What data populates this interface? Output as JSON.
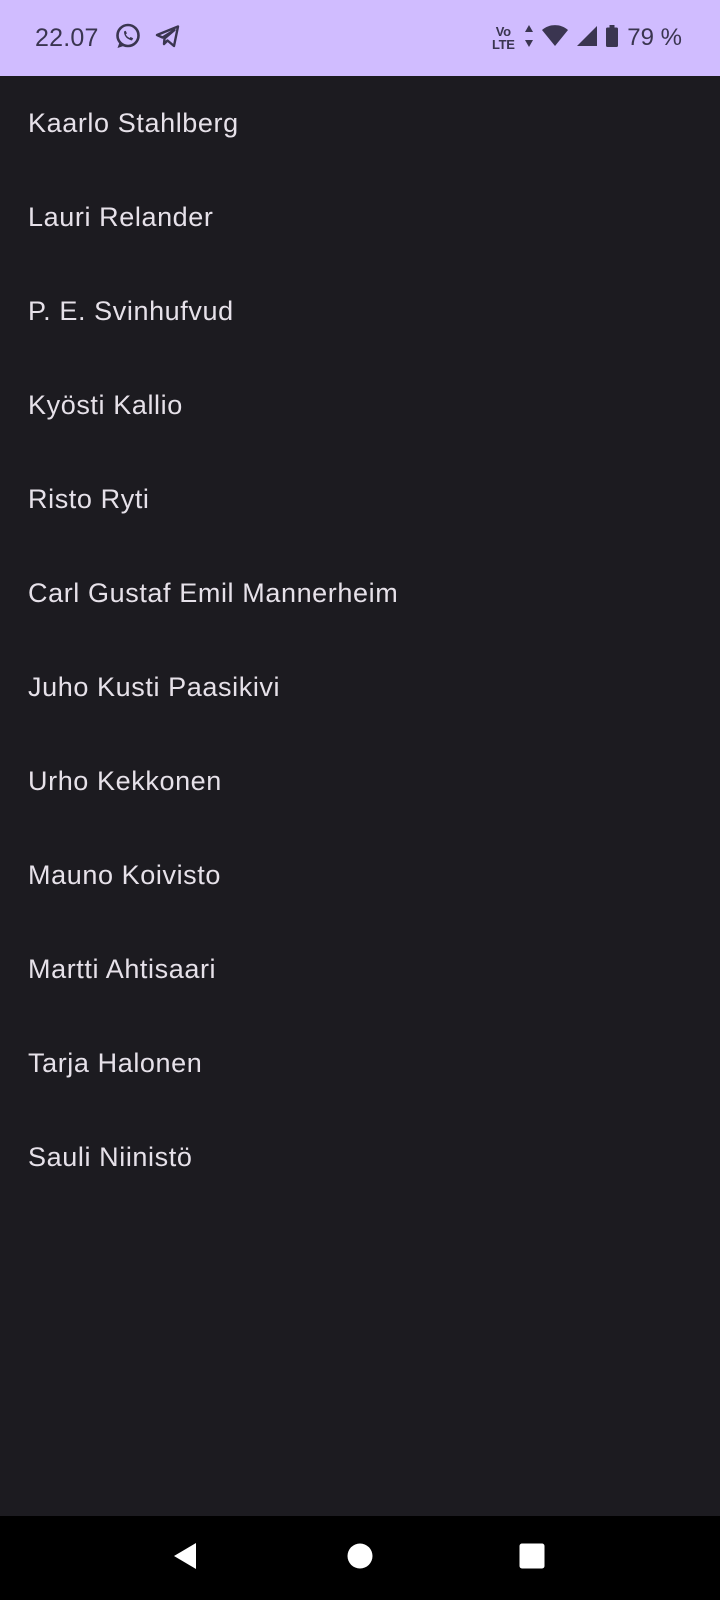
{
  "status_bar": {
    "time": "22.07",
    "left_icons": [
      "whatsapp-icon",
      "telegram-icon"
    ],
    "network_badge": [
      "Vo",
      "LTE"
    ],
    "battery_percent": "79 %",
    "background": "#d0bcff"
  },
  "presidents": {
    "items": [
      {
        "name": "Kaarlo Stahlberg"
      },
      {
        "name": "Lauri Relander"
      },
      {
        "name": "P. E. Svinhufvud"
      },
      {
        "name": "Kyösti Kallio"
      },
      {
        "name": "Risto Ryti"
      },
      {
        "name": "Carl Gustaf Emil Mannerheim"
      },
      {
        "name": "Juho Kusti Paasikivi"
      },
      {
        "name": "Urho Kekkonen"
      },
      {
        "name": "Mauno Koivisto"
      },
      {
        "name": "Martti Ahtisaari"
      },
      {
        "name": "Tarja Halonen"
      },
      {
        "name": "Sauli Niinistö"
      }
    ]
  },
  "nav_bar": {
    "buttons": [
      "back-icon",
      "home-icon",
      "recents-icon"
    ]
  },
  "colors": {
    "background": "#1c1b20",
    "text": "#e6e1e9",
    "status_text": "#3a3550"
  }
}
